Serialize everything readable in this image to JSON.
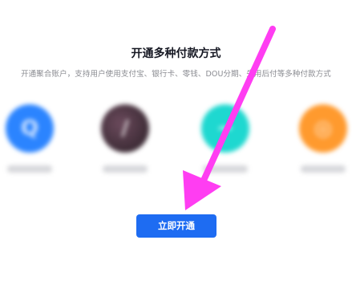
{
  "promo": {
    "title": "开通多种付款方式",
    "subtitle": "开通聚合账户，支持用户使用支付宝、银行卡、零钱、DOU分期、先用后付等多种付款方式",
    "button_label": "立即开通"
  },
  "methods": [
    {
      "icon": "circle-q-icon",
      "color": "#2b84ff",
      "glyph": "Q"
    },
    {
      "icon": "slash-icon",
      "color": "#3a2a34",
      "glyph": "/"
    },
    {
      "icon": "cyan-icon",
      "color": "#1ed8d0",
      "glyph": "~"
    },
    {
      "icon": "orange-icon",
      "color": "#ff9a2e",
      "glyph": "◎"
    }
  ],
  "annotation": {
    "icon": "pink-pointer-arrow-icon",
    "color": "#ff3df2"
  }
}
